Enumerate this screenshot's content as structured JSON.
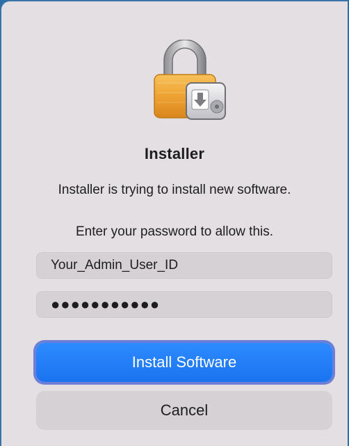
{
  "dialog": {
    "title": "Installer",
    "message": "Installer is trying to install new software.",
    "prompt": "Enter your password to allow this.",
    "icon": "lock-installer-icon"
  },
  "fields": {
    "username_value": "Your_Admin_User_ID",
    "password_value": "●●●●●●●●●●●"
  },
  "buttons": {
    "install_label": "Install Software",
    "cancel_label": "Cancel"
  },
  "colors": {
    "accent": "#1a73f0",
    "dialog_bg": "#e4dfe3",
    "lock_body": "#f0a830"
  }
}
